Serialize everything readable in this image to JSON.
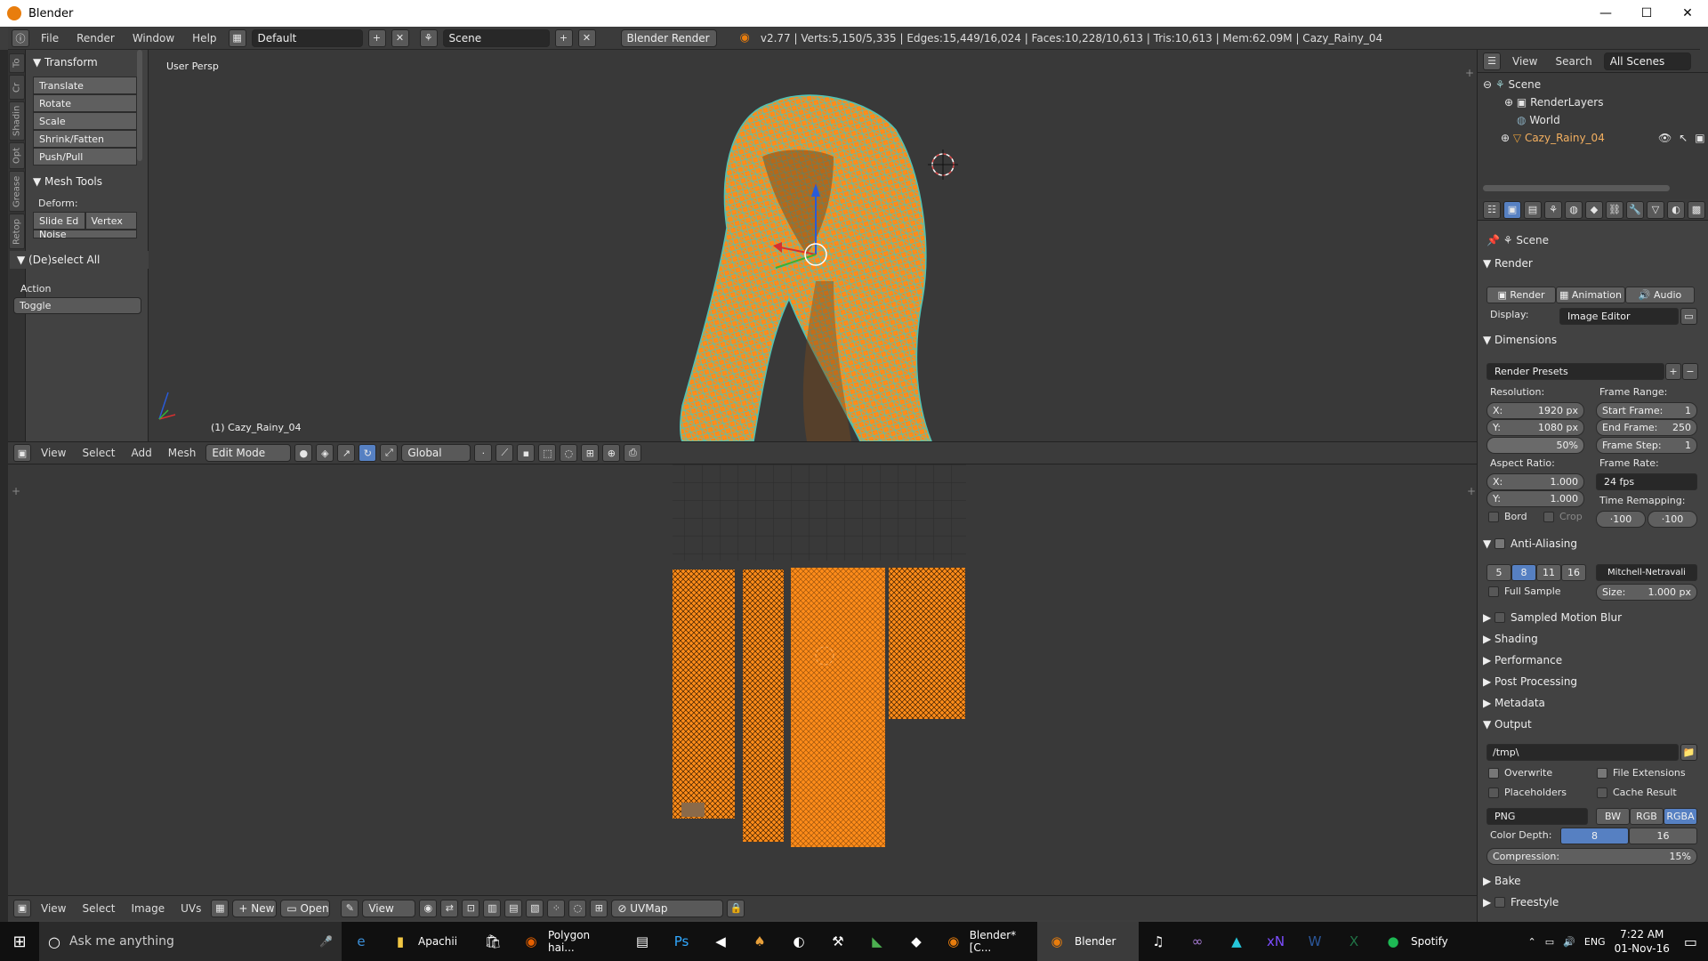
{
  "window": {
    "title": "Blender",
    "min": "—",
    "max": "☐",
    "close": "✕"
  },
  "menubar": {
    "items": [
      "File",
      "Render",
      "Window",
      "Help"
    ],
    "layout": "Default",
    "scene": "Scene",
    "engine": "Blender Render",
    "stats": "v2.77 | Verts:5,150/5,335 | Edges:15,449/16,024 | Faces:10,228/10,613 | Tris:10,613 | Mem:62.09M | Cazy_Rainy_04"
  },
  "tool_tabs": [
    "To",
    "Cr",
    "Shadin",
    "Opt",
    "Grease",
    "Retop"
  ],
  "toolshelf": {
    "transform_title": "Transform",
    "transform_buttons": [
      "Translate",
      "Rotate",
      "Scale",
      "Shrink/Fatten",
      "Push/Pull"
    ],
    "mesh_tools_title": "Mesh Tools",
    "deform_label": "Deform:",
    "slide_edge": "Slide Ed",
    "vertex": "Vertex",
    "noise": "Noise",
    "deselect_title": "(De)select All",
    "action_label": "Action",
    "action_value": "Toggle"
  },
  "viewport": {
    "label": "User Persp",
    "object_label": "(1) Cazy_Rainy_04"
  },
  "viewport_header": {
    "menus": [
      "View",
      "Select",
      "Add",
      "Mesh"
    ],
    "mode": "Edit Mode",
    "orientation": "Global"
  },
  "uv_header": {
    "menus": [
      "View",
      "Select",
      "Image",
      "UVs"
    ],
    "new": "New",
    "open": "Open",
    "view": "View",
    "uvmap": "UVMap"
  },
  "outliner": {
    "view": "View",
    "search": "Search",
    "filter": "All Scenes",
    "items": [
      "Scene",
      "RenderLayers",
      "World",
      "Cazy_Rainy_04"
    ]
  },
  "props": {
    "breadcrumb": "Scene",
    "render_title": "Render",
    "render_btn": "Render",
    "animation_btn": "Animation",
    "audio_btn": "Audio",
    "display_label": "Display:",
    "display_value": "Image Editor",
    "dimensions_title": "Dimensions",
    "render_presets": "Render Presets",
    "resolution_label": "Resolution:",
    "res_x": "X:",
    "res_x_val": "1920 px",
    "res_y": "Y:",
    "res_y_val": "1080 px",
    "res_pct": "50%",
    "frame_range_label": "Frame Range:",
    "start_frame": "Start Frame:",
    "start_frame_val": "1",
    "end_frame": "End Frame:",
    "end_frame_val": "250",
    "frame_step": "Frame Step:",
    "frame_step_val": "1",
    "aspect_label": "Aspect Ratio:",
    "asp_x": "X:",
    "asp_x_val": "1.000",
    "asp_y": "Y:",
    "asp_y_val": "1.000",
    "frame_rate_label": "Frame Rate:",
    "frame_rate_val": "24 fps",
    "time_remap_label": "Time Remapping:",
    "remap_old": "·100",
    "remap_new": "·100",
    "bord": "Bord",
    "crop": "Crop",
    "aa_title": "Anti-Aliasing",
    "aa_samples": [
      "5",
      "8",
      "11",
      "16"
    ],
    "aa_filter": "Mitchell-Netravali",
    "full_sample": "Full Sample",
    "size_label": "Size:",
    "size_val": "1.000 px",
    "collapsed": [
      "Sampled Motion Blur",
      "Shading",
      "Performance",
      "Post Processing",
      "Metadata"
    ],
    "output_title": "Output",
    "output_path": "/tmp\\",
    "overwrite": "Overwrite",
    "file_ext": "File Extensions",
    "placeholders": "Placeholders",
    "cache_result": "Cache Result",
    "format": "PNG",
    "bw": "BW",
    "rgb": "RGB",
    "rgba": "RGBA",
    "color_depth_label": "Color Depth:",
    "depth_8": "8",
    "depth_16": "16",
    "compression_label": "Compression:",
    "compression_val": "15%",
    "bake": "Bake",
    "freestyle": "Freestyle"
  },
  "taskbar": {
    "search": "Ask me anything",
    "apps": [
      "Apachii",
      "Polygon hai...",
      "Blender* [C...",
      "Blender",
      "Spotify"
    ],
    "lang": "ENG",
    "time": "7:22 AM",
    "date": "01-Nov-16"
  },
  "colors": {
    "accent": "#5680c2",
    "mesh_orange": "#ff8c1a",
    "wire_teal": "#4fc3b5"
  }
}
